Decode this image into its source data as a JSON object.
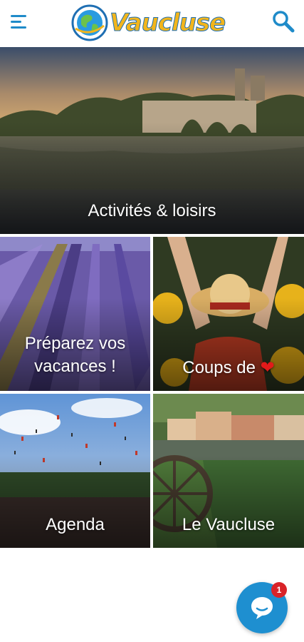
{
  "header": {
    "menu_icon": "hamburger-menu-icon",
    "logo_text": "Vaucluse",
    "logo_icon": "globe-icon",
    "search_icon": "search-icon",
    "brand_blue": "#1f8bc9",
    "brand_yellow": "#f2b51c"
  },
  "tiles": [
    {
      "label": "Activités & loisirs",
      "image": "river-bridge-castle-sunset"
    },
    {
      "label_line1": "Préparez vos",
      "label_line2": "vacances !",
      "image": "lavender-field"
    },
    {
      "label": "Coups de",
      "heart": "❤",
      "image": "woman-sunflowers"
    },
    {
      "label": "Agenda",
      "image": "festival-crowd-confetti"
    },
    {
      "label": "Le Vaucluse",
      "image": "village-water-wheel"
    }
  ],
  "chat": {
    "icon": "chat-bubble-icon",
    "badge_count": "1",
    "color": "#1e8fd0"
  }
}
